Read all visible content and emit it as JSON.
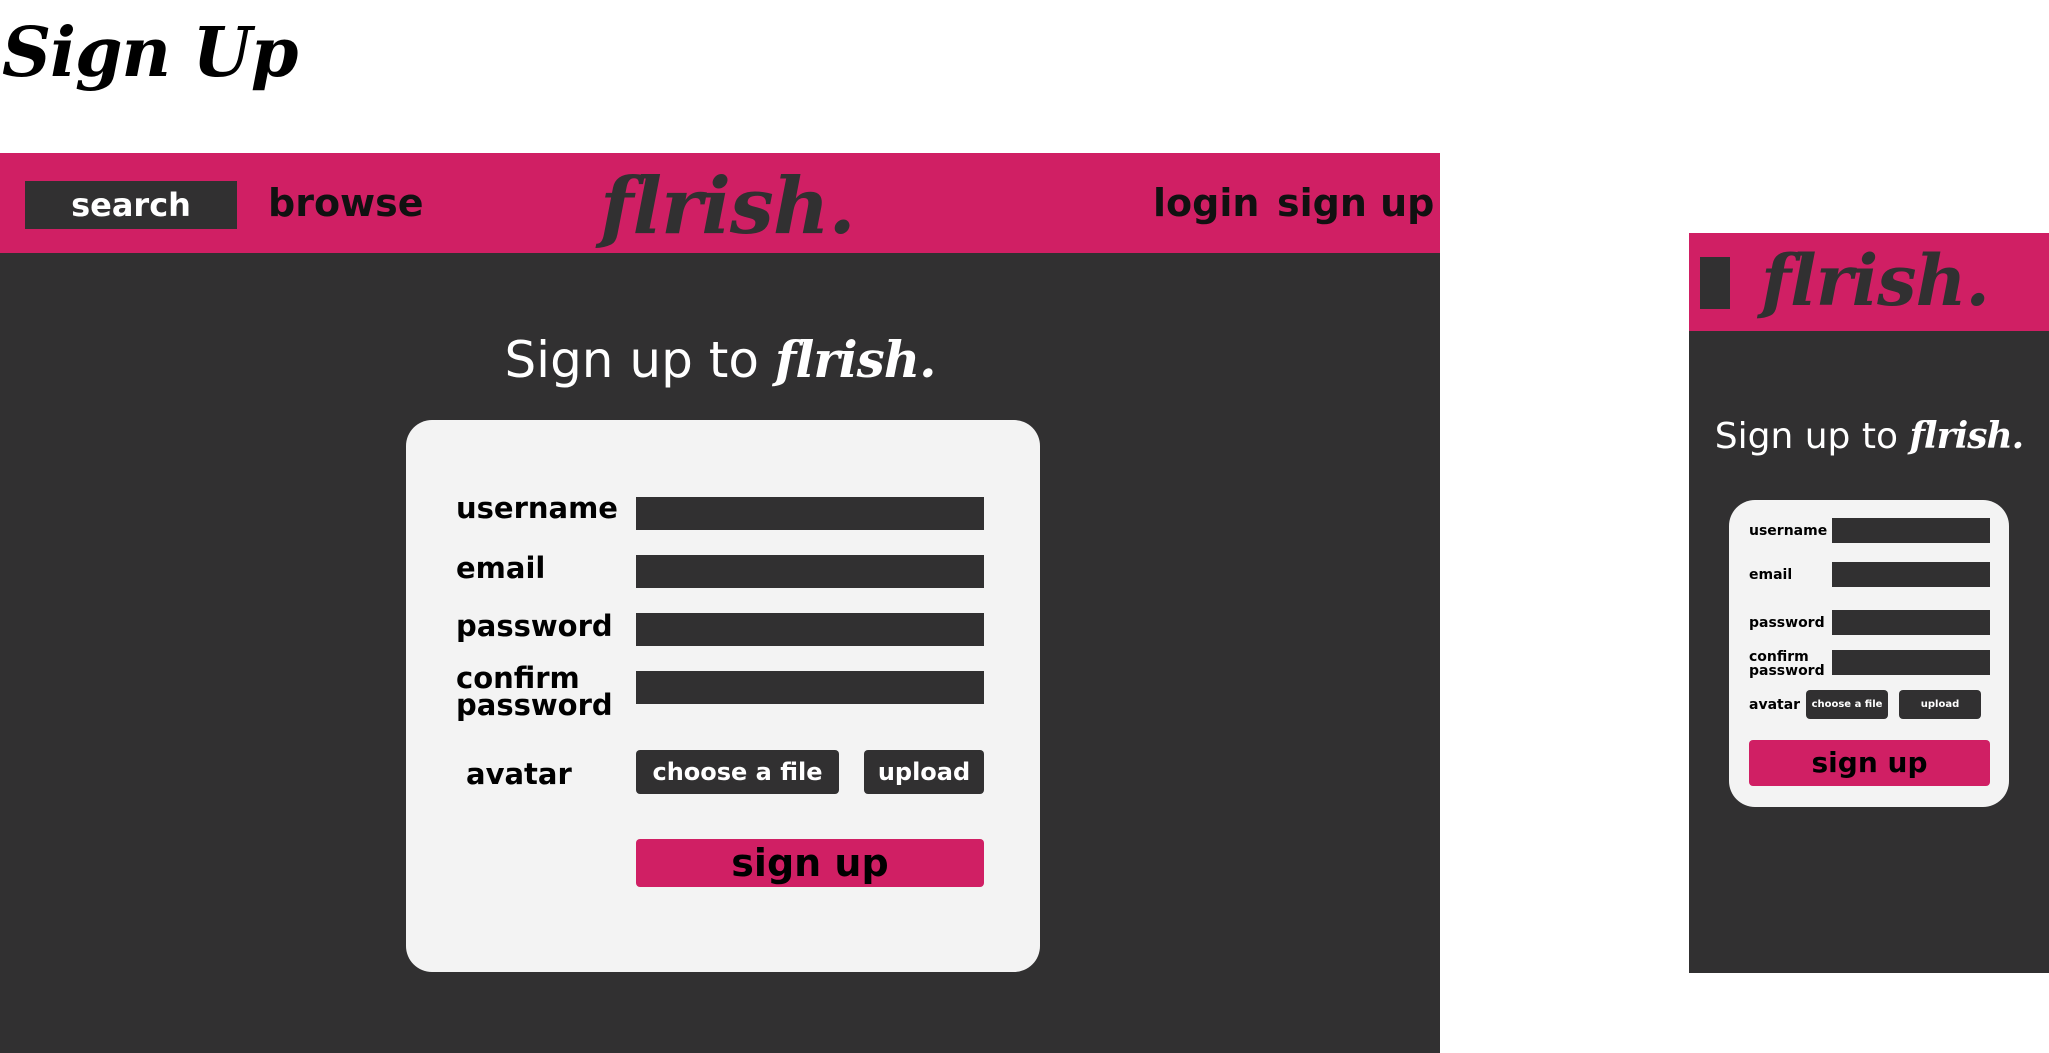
{
  "page_title": "Sign Up",
  "colors": {
    "brand": "#d01f64",
    "dark": "#313031",
    "card": "#f3f3f3",
    "white": "#ffffff"
  },
  "desktop": {
    "nav": {
      "search_label": "search",
      "browse_label": "browse",
      "logo": "flrish.",
      "login_label": "login",
      "signup_label": "sign up"
    },
    "heading_prefix": "Sign up to ",
    "heading_logo": "flrish.",
    "form": {
      "username_label": "username",
      "email_label": "email",
      "password_label": "password",
      "confirm_label_line1": "confirm",
      "confirm_label_line2": "password",
      "avatar_label": "avatar",
      "choose_file_label": "choose a file",
      "upload_label": "upload",
      "submit_label": "sign up"
    }
  },
  "mobile": {
    "nav": {
      "logo": "flrish."
    },
    "heading_prefix": "Sign up to ",
    "heading_logo": "flrish.",
    "form": {
      "username_label": "username",
      "email_label": "email",
      "password_label": "password",
      "confirm_label_line1": "confirm",
      "confirm_label_line2": "password",
      "avatar_label": "avatar",
      "choose_file_label": "choose a file",
      "upload_label": "upload",
      "submit_label": "sign up"
    }
  }
}
